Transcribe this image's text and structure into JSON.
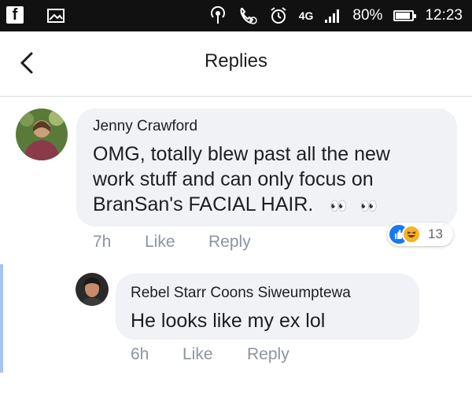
{
  "status_bar": {
    "icons": [
      "facebook-icon",
      "image-icon",
      "hotspot-icon",
      "call-icon",
      "alarm-icon",
      "signal-icon"
    ],
    "network": "4G",
    "battery": "80%",
    "time": "12:23"
  },
  "header": {
    "title": "Replies",
    "back_icon": "chevron-left-icon"
  },
  "comment": {
    "author": "Jenny Crawford",
    "text": "OMG, totally blew past all the new work stuff and can only focus on BranSan's FACIAL HAIR.",
    "time": "7h",
    "like_label": "Like",
    "reply_label": "Reply",
    "reaction_count": "13",
    "reactions": [
      "like",
      "haha"
    ],
    "avatar_colors": [
      "#5a7a3a",
      "#8b3a4a",
      "#c9a07a"
    ]
  },
  "reply": {
    "author": "Rebel Starr Coons Siweumptewa",
    "text": "He looks like my ex lol",
    "time": "6h",
    "like_label": "Like",
    "reply_label": "Reply",
    "avatar_colors": [
      "#2a2a2a",
      "#c98b6a"
    ]
  },
  "colors": {
    "accent": "#1877f2",
    "bubble": "#f0f2f5",
    "meta": "#8d949e",
    "thread_bar": "#a6c4ef"
  }
}
